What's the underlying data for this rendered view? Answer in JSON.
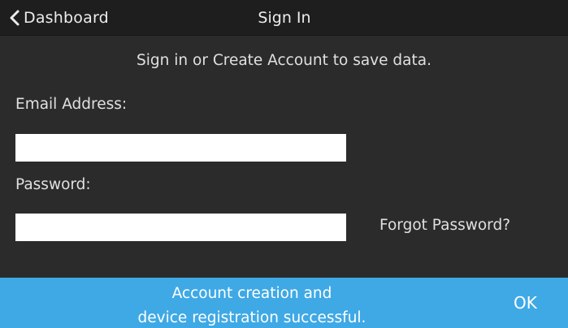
{
  "header": {
    "back_label": "Dashboard",
    "title": "Sign In"
  },
  "main": {
    "subtitle": "Sign in or Create Account to save data.",
    "email": {
      "label": "Email Address:",
      "value": ""
    },
    "password": {
      "label": "Password:",
      "value": ""
    },
    "forgot_password": "Forgot Password?"
  },
  "toast": {
    "line1": "Account creation and",
    "line2": "device registration successful.",
    "ok_label": "OK",
    "color": "#3fa9e6"
  },
  "colors": {
    "background": "#2b2b2b",
    "header_background": "#1e1e1e",
    "text": "#e0e0e0"
  },
  "icons": {
    "back": "chevron-left-icon"
  }
}
